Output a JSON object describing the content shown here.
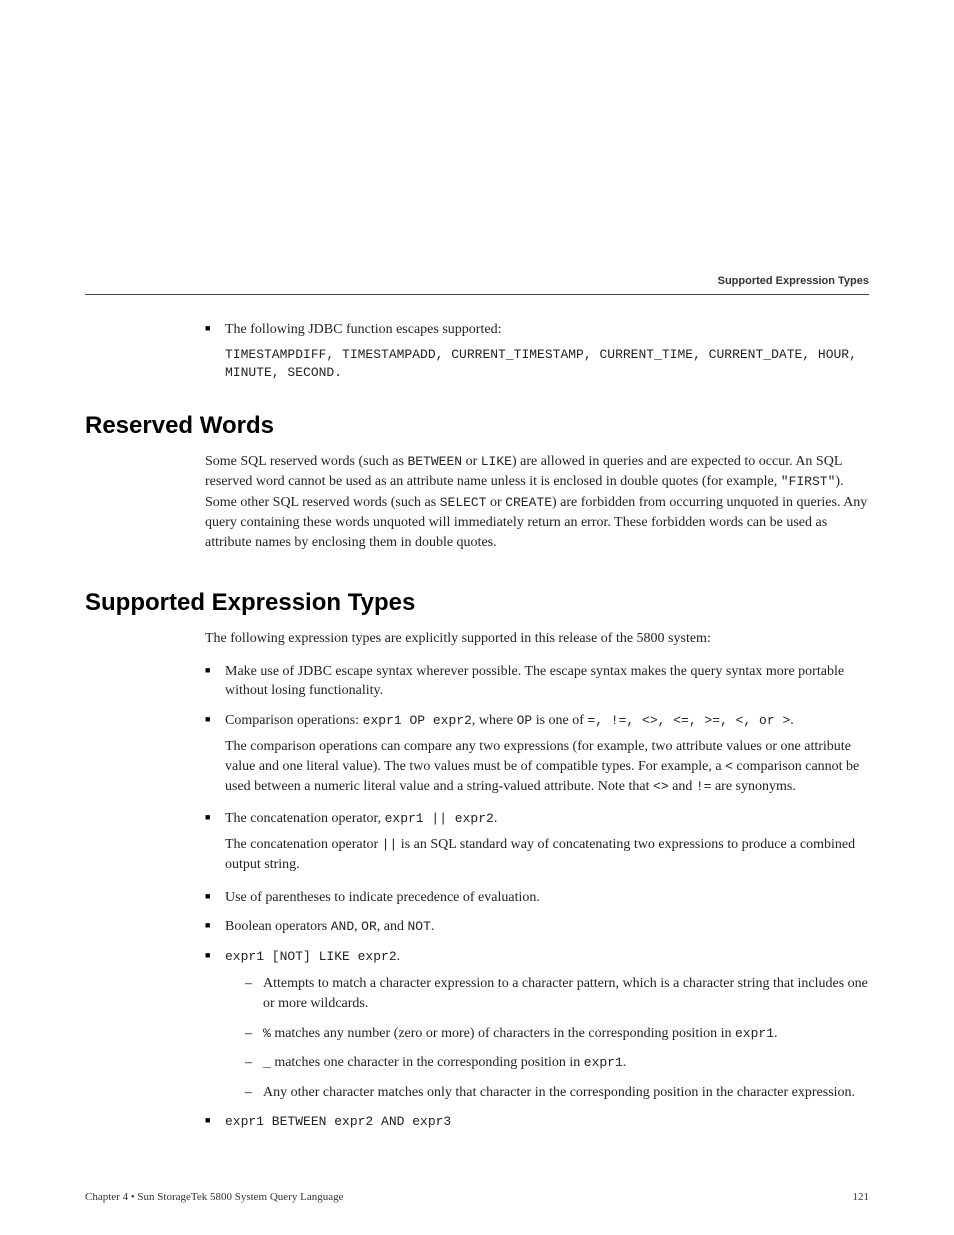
{
  "runningHeader": "Supported Expression Types",
  "topBullet": {
    "lead": "The following JDBC function escapes supported:",
    "code": "TIMESTAMPDIFF, TIMESTAMPADD, CURRENT_TIMESTAMP, CURRENT_TIME, CURRENT_DATE, HOUR, MINUTE, SECOND."
  },
  "reserved": {
    "heading": "Reserved Words",
    "p1a": "Some SQL reserved words (such as ",
    "c1": "BETWEEN",
    "p1b": " or ",
    "c2": "LIKE",
    "p1c": ") are allowed in queries and are expected to occur. An SQL reserved word cannot be used as an attribute name unless it is enclosed in double quotes (for example, ",
    "c3": "\"FIRST\"",
    "p1d": "). Some other SQL reserved words (such as ",
    "c4": "SELECT",
    "p1e": " or ",
    "c5": "CREATE",
    "p1f": ") are forbidden from occurring unquoted in queries. Any query containing these words unquoted will immediately return an error. These forbidden words can be used as attribute names by enclosing them in double quotes."
  },
  "supported": {
    "heading": "Supported Expression Types",
    "intro": "The following expression types are explicitly supported in this release of the 5800 system:",
    "b1": "Make use of JDBC escape syntax wherever possible. The escape syntax makes the query syntax more portable without losing functionality.",
    "b2a": "Comparison operations: ",
    "b2code": "expr1 OP expr2",
    "b2b": ", where ",
    "b2op": "OP",
    "b2c": " is one of ",
    "b2ops": "=, !=, <>, <=, >=, <, or >",
    "b2d": ".",
    "b2p2a": "The comparison operations can compare any two expressions (for example, two attribute values or one attribute value and one literal value). The two values must be of compatible types. For example, a ",
    "b2lt": "<",
    "b2p2b": " comparison cannot be used between a numeric literal value and a string-valued attribute. Note that ",
    "b2ne1": "<>",
    "b2p2c": " and ",
    "b2ne2": "!=",
    "b2p2d": " are synonyms.",
    "b3a": "The concatenation operator, ",
    "b3code": "expr1 || expr2",
    "b3b": ".",
    "b3p2a": "The concatenation operator ",
    "b3pipes": "||",
    "b3p2b": " is an SQL standard way of concatenating two expressions to produce a combined output string.",
    "b4": "Use of parentheses to indicate precedence of evaluation.",
    "b5a": "Boolean operators ",
    "b5and": "AND",
    "b5b": ", ",
    "b5or": "OR",
    "b5c": ", and ",
    "b5not": "NOT",
    "b5d": ".",
    "b6code": "expr1 [NOT] LIKE expr2",
    "b6dot": ".",
    "b6s1": "Attempts to match a character expression to a character pattern, which is a character string that includes one or more wildcards.",
    "b6s2a": "%",
    "b6s2b": " matches any number (zero or more) of characters in the corresponding position in ",
    "b6s2c": "expr1",
    "b6s2d": ".",
    "b6s3a": "_",
    "b6s3b": " matches one character in the corresponding position in ",
    "b6s3c": "expr1",
    "b6s3d": ".",
    "b6s4": "Any other character matches only that character in the corresponding position in the character expression.",
    "b7code": "expr1 BETWEEN expr2 AND expr3"
  },
  "footer": {
    "left": "Chapter 4 • Sun StorageTek 5800 System Query Language",
    "right": "121"
  }
}
